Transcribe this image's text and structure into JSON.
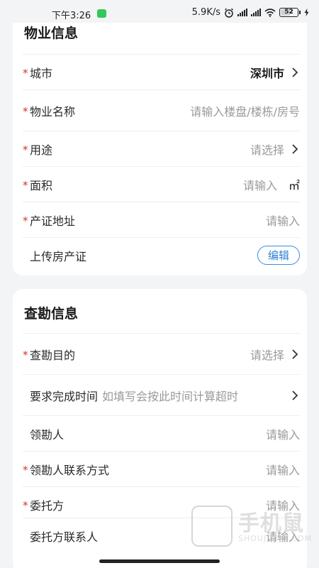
{
  "status_bar": {
    "time": "下午3:26",
    "net_speed": "5.9K/s",
    "battery": "52"
  },
  "property_section": {
    "title": "物业信息",
    "city": {
      "label": "城市",
      "value": "深圳市"
    },
    "property_name": {
      "label": "物业名称",
      "placeholder": "请输入楼盘/楼栋/房号"
    },
    "usage": {
      "label": "用途",
      "placeholder": "请选择"
    },
    "area": {
      "label": "面积",
      "placeholder": "请输入",
      "unit": "㎡"
    },
    "cert_address": {
      "label": "产证地址",
      "placeholder": "请输入"
    },
    "upload_cert": {
      "label": "上传房产证",
      "button": "编辑"
    }
  },
  "survey_section": {
    "title": "查勘信息",
    "purpose": {
      "label": "查勘目的",
      "placeholder": "请选择"
    },
    "deadline": {
      "label": "要求完成时间",
      "placeholder": "如填写会按此时间计算超时"
    },
    "surveyor": {
      "label": "领勘人",
      "placeholder": "请输入"
    },
    "surveyor_contact": {
      "label": "领勘人联系方式",
      "placeholder": "请输入"
    },
    "client": {
      "label": "委托方",
      "placeholder": "请输入"
    },
    "client_contact": {
      "label": "委托方联系人",
      "placeholder": "请输入"
    }
  },
  "watermark": {
    "text": "手机鼠",
    "sub": "SHOUJISHU.COM"
  },
  "icons": {
    "chevron": "chevron-right-icon",
    "wifi": "wifi-icon",
    "signal": "signal-icon",
    "alarm": "alarm-icon",
    "battery": "battery-icon",
    "charging": "charging-icon"
  },
  "colors": {
    "required": "#d0352b",
    "accent": "#2f7fd6",
    "placeholder": "#9a9a9a",
    "background": "#f3f4f6"
  }
}
